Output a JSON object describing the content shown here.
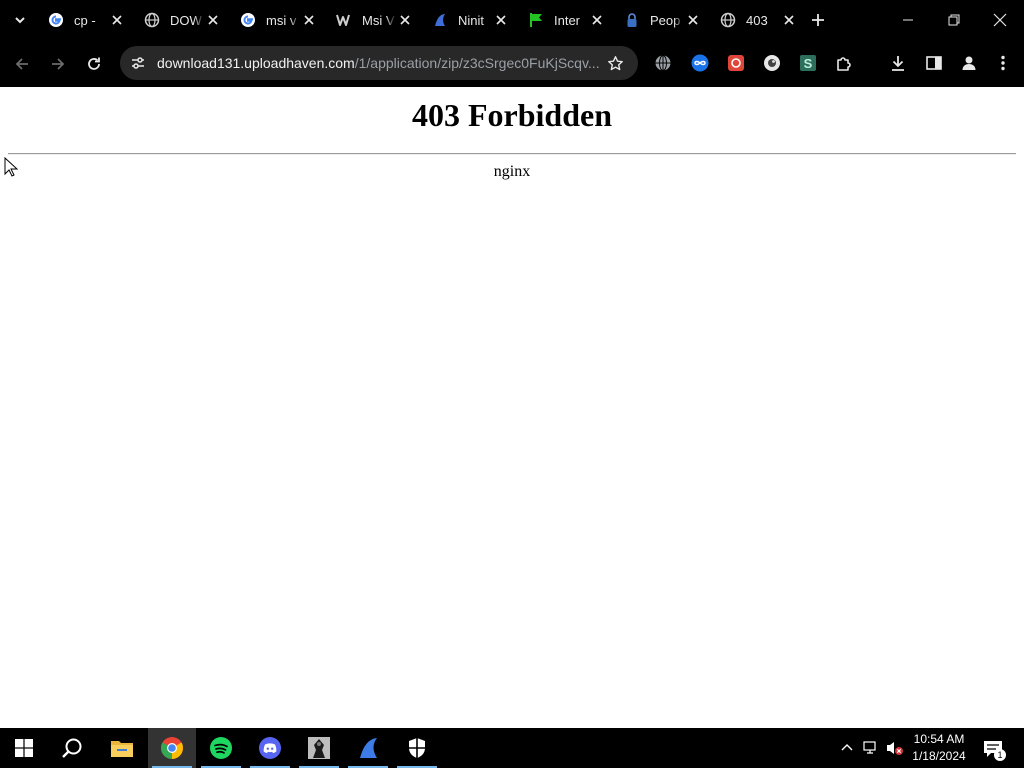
{
  "browser": {
    "tabs": [
      {
        "title": "cp -",
        "icon": "google-icon"
      },
      {
        "title": "DOW",
        "icon": "globe-icon"
      },
      {
        "title": "msi v",
        "icon": "google-icon"
      },
      {
        "title": "Msi V",
        "icon": "w-logo-icon"
      },
      {
        "title": "Ninit",
        "icon": "ninite-icon"
      },
      {
        "title": "Inter",
        "icon": "green-flag-icon"
      },
      {
        "title": "Peop",
        "icon": "lock-icon"
      },
      {
        "title": "403",
        "icon": "globe-icon"
      }
    ],
    "active_tab_index": 7,
    "url_host": "download131.uploadhaven.com",
    "url_path": "/1/application/zip/z3cSrgec0FuKjScqv..."
  },
  "page": {
    "heading": "403 Forbidden",
    "server": "nginx"
  },
  "taskbar": {
    "time": "10:54 AM",
    "date": "1/18/2024",
    "notification_count": "1"
  },
  "colors": {
    "accent": "#76b9ed",
    "spotify": "#1ed760",
    "discord": "#5865f2",
    "chrome_red": "#ea4335",
    "chrome_yellow": "#fbbc04",
    "chrome_green": "#34a853",
    "chrome_blue": "#4285f4"
  }
}
